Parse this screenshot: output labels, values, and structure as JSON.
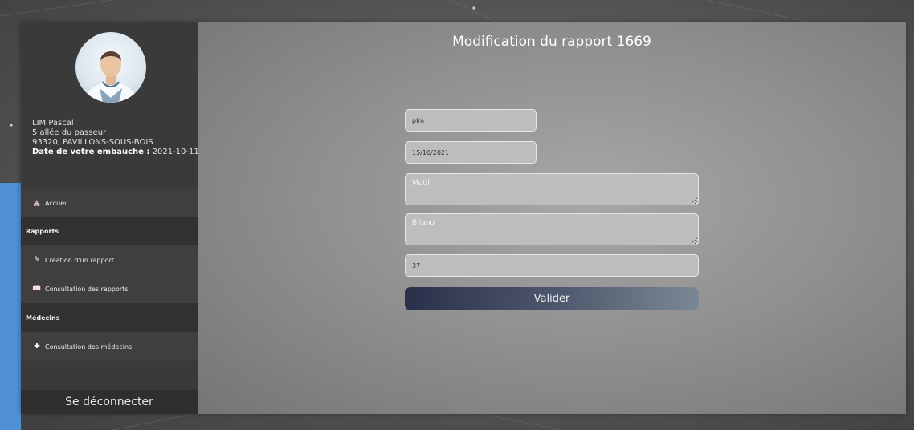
{
  "user": {
    "name": "LIM Pascal",
    "address_line1": "5 allée du passeur",
    "address_line2": "93320, PAVILLONS-SOUS-BOIS",
    "hire_date_label": "Date de votre embauche :",
    "hire_date_value": "2021-10-11"
  },
  "nav": {
    "home": {
      "label": "Accueil",
      "icon": "home-icon"
    },
    "reports_section": "Rapports",
    "create_report": {
      "label": "Création d'un rapport",
      "icon": "edit-icon"
    },
    "view_reports": {
      "label": "Consultation des rapports",
      "icon": "book-icon"
    },
    "doctors_section": "Médecins",
    "view_doctors": {
      "label": "Consultation des médecins",
      "icon": "plus-icon"
    },
    "logout": "Se déconnecter"
  },
  "form": {
    "title": "Modification du rapport 1669",
    "field1_value": "plm",
    "date_value": "15/10/2021",
    "motif_placeholder": "Motif",
    "bilan_placeholder": "Bilano",
    "number_value": "37",
    "submit_label": "Valider"
  },
  "colors": {
    "sidebar": "#3a3a3a",
    "button_start": "#2b304a",
    "button_end": "#7a8894",
    "accent_edge": "#4f8fd4"
  }
}
